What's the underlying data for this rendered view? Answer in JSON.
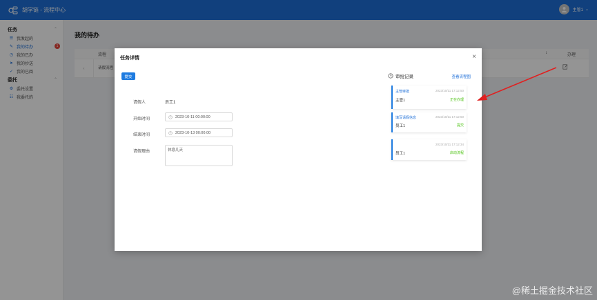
{
  "header": {
    "app_title": "胡学链 - 流程中心",
    "user_name": "主管1",
    "user_caret": "⌄"
  },
  "sidebar": {
    "group_task": "任务",
    "group_delegate": "委托",
    "items": [
      {
        "label": "我发起的",
        "icon": "list-icon"
      },
      {
        "label": "我的待办",
        "icon": "edit-icon",
        "badge": "1"
      },
      {
        "label": "我的已办",
        "icon": "clock-icon"
      },
      {
        "label": "我的抄送",
        "icon": "send-icon"
      },
      {
        "label": "我的已阅",
        "icon": "check-icon"
      }
    ],
    "delegate_items": [
      {
        "label": "委托设置",
        "icon": "gear-icon"
      },
      {
        "label": "我委托的",
        "icon": "list-icon"
      }
    ]
  },
  "main": {
    "page_title": "我的待办",
    "table_headers": {
      "process": "流程",
      "action": "办理"
    },
    "row": {
      "process": "请假流程"
    }
  },
  "dialog": {
    "title": "任务详情",
    "submit_label": "提交",
    "fields": {
      "applicant_label": "请假人",
      "applicant_value": "员工1",
      "start_label": "开始时间",
      "start_value": "2023-10-11 00:00:00",
      "end_label": "结束时间",
      "end_value": "2023-10-13 00:00:00",
      "reason_label": "请假理由",
      "reason_value": "休息几天"
    },
    "audit_title": "审批记录",
    "view_flow_label": "查看流程图",
    "records": [
      {
        "name": "主管审批",
        "time": "2023/10/11 17:12:50",
        "user": "主管1",
        "status": "正在办理"
      },
      {
        "name": "填写请假信息",
        "time": "2023/10/11 17:12:50",
        "user": "员工1",
        "status": "提交"
      },
      {
        "name": "",
        "time": "2023/10/11 17:12:34",
        "user": "员工1",
        "status": "启动流程"
      }
    ]
  },
  "watermark": "@稀土掘金技术社区",
  "colors": {
    "primary": "#1e6fd8",
    "success": "#52c41a",
    "danger": "#e6453c",
    "arrow": "#e02020"
  }
}
